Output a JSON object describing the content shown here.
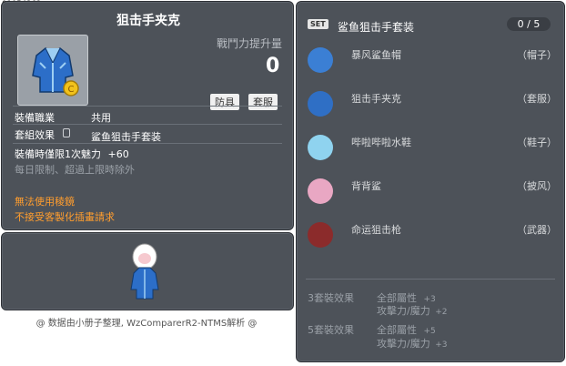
{
  "item_id": "01054263",
  "item": {
    "name": "狙击手夹克",
    "power_label": "戰鬥力提升量",
    "power_value": "0",
    "tags": [
      "防具",
      "套服"
    ],
    "job_label": "裝備職業",
    "job_value": "共用",
    "set_label": "套組效果",
    "set_value": "鲨鱼狙击手套装",
    "bonus_prefix": "裝備時僅限1次魅力",
    "bonus_value": "+60",
    "limit_text": "每日限制、超過上限時除外",
    "warning_1": "無法使用稜鏡",
    "warning_2": "不接受客製化插畫請求"
  },
  "footer_credit": "@ 数据由小册子整理, WzComparerR2-NTMS解析 @",
  "set_panel": {
    "badge": "SET",
    "title": "鲨鱼狙击手套装",
    "count": "0 / 5",
    "items": [
      {
        "name": "暴风鲨鱼帽",
        "slot": "（帽子）",
        "icon": "shark-hat-icon",
        "color": "#3b7fd4"
      },
      {
        "name": "狙击手夹克",
        "slot": "（套服）",
        "icon": "jacket-icon",
        "color": "#2f6fc5"
      },
      {
        "name": "哔啦哔啦水鞋",
        "slot": "（鞋子）",
        "icon": "water-shoes-icon",
        "color": "#8fd3ef"
      },
      {
        "name": "背背鲨",
        "slot": "（披风）",
        "icon": "shark-cape-icon",
        "color": "#e9a7c3"
      },
      {
        "name": "命运狙击枪",
        "slot": "（武器）",
        "icon": "sniper-gun-icon",
        "color": "#8b2b2b"
      }
    ],
    "effects": [
      {
        "label": "3套裝效果",
        "lines": [
          {
            "text": "全部屬性",
            "value": "+3"
          },
          {
            "text": "攻擊力/魔力",
            "value": "+2"
          }
        ]
      },
      {
        "label": "5套裝效果",
        "lines": [
          {
            "text": "全部屬性",
            "value": "+5"
          },
          {
            "text": "攻擊力/魔力",
            "value": "+3"
          }
        ]
      }
    ]
  }
}
